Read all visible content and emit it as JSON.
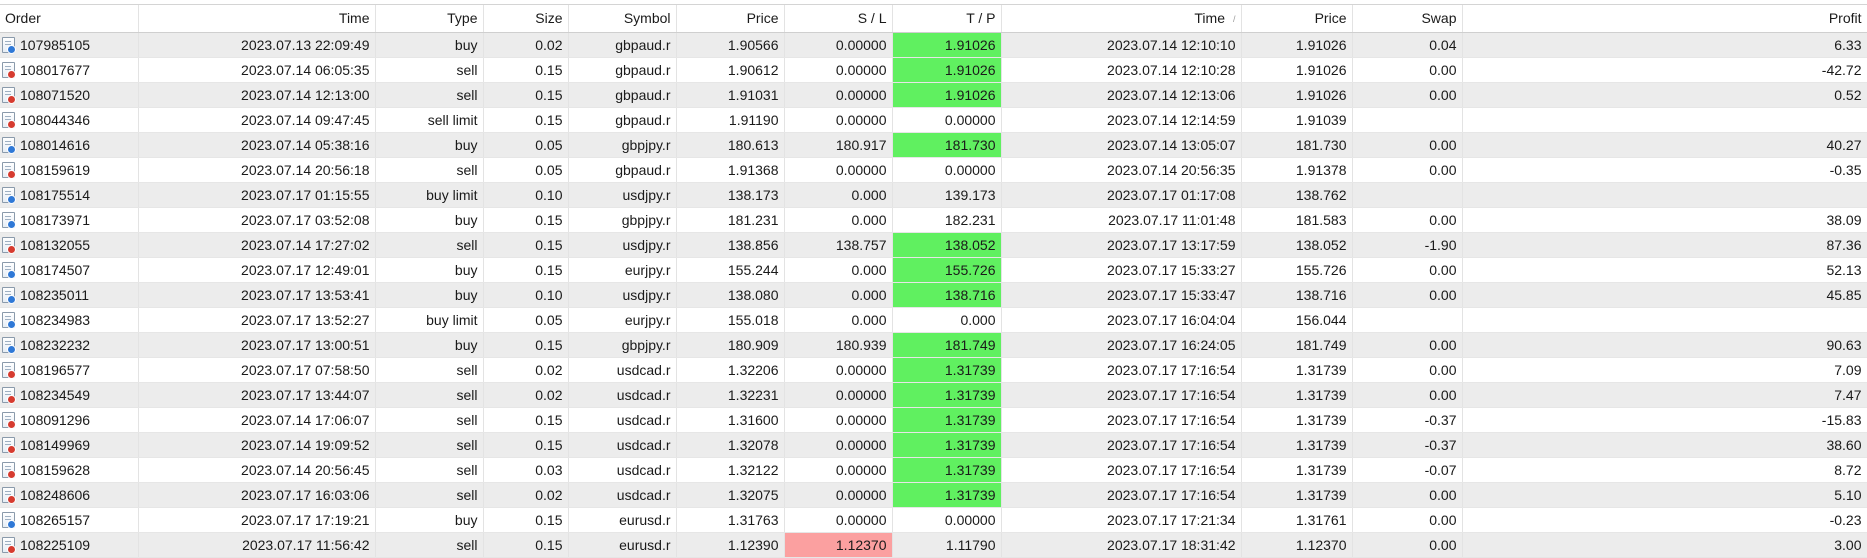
{
  "columns": [
    {
      "key": "order",
      "label": "Order"
    },
    {
      "key": "time",
      "label": "Time"
    },
    {
      "key": "type",
      "label": "Type"
    },
    {
      "key": "size",
      "label": "Size"
    },
    {
      "key": "symbol",
      "label": "Symbol"
    },
    {
      "key": "price",
      "label": "Price"
    },
    {
      "key": "sl",
      "label": "S / L"
    },
    {
      "key": "tp",
      "label": "T / P"
    },
    {
      "key": "close_time",
      "label": "Time",
      "sort_indicator": "/"
    },
    {
      "key": "close_price",
      "label": "Price"
    },
    {
      "key": "swap",
      "label": "Swap"
    },
    {
      "key": "profit",
      "label": "Profit"
    }
  ],
  "colors": {
    "hit_tp": "#60f060",
    "hit_sl": "#fba0a0",
    "buy_icon": "#2f78d6",
    "sell_icon": "#d63b2f"
  },
  "rows": [
    {
      "order": "107985105",
      "time": "2023.07.13 22:09:49",
      "type": "buy",
      "size": "0.02",
      "symbol": "gbpaud.r",
      "price": "1.90566",
      "sl": "0.00000",
      "tp": "1.91026",
      "close_time": "2023.07.14 12:10:10",
      "close_price": "1.91026",
      "swap": "0.04",
      "profit": "6.33",
      "highlight": "tp"
    },
    {
      "order": "108017677",
      "time": "2023.07.14 06:05:35",
      "type": "sell",
      "size": "0.15",
      "symbol": "gbpaud.r",
      "price": "1.90612",
      "sl": "0.00000",
      "tp": "1.91026",
      "close_time": "2023.07.14 12:10:28",
      "close_price": "1.91026",
      "swap": "0.00",
      "profit": "-42.72",
      "highlight": "tp"
    },
    {
      "order": "108071520",
      "time": "2023.07.14 12:13:00",
      "type": "sell",
      "size": "0.15",
      "symbol": "gbpaud.r",
      "price": "1.91031",
      "sl": "0.00000",
      "tp": "1.91026",
      "close_time": "2023.07.14 12:13:06",
      "close_price": "1.91026",
      "swap": "0.00",
      "profit": "0.52",
      "highlight": "tp"
    },
    {
      "order": "108044346",
      "time": "2023.07.14 09:47:45",
      "type": "sell limit",
      "size": "0.15",
      "symbol": "gbpaud.r",
      "price": "1.91190",
      "sl": "0.00000",
      "tp": "0.00000",
      "close_time": "2023.07.14 12:14:59",
      "close_price": "1.91039",
      "swap": "",
      "profit": "",
      "highlight": ""
    },
    {
      "order": "108014616",
      "time": "2023.07.14 05:38:16",
      "type": "buy",
      "size": "0.05",
      "symbol": "gbpjpy.r",
      "price": "180.613",
      "sl": "180.917",
      "tp": "181.730",
      "close_time": "2023.07.14 13:05:07",
      "close_price": "181.730",
      "swap": "0.00",
      "profit": "40.27",
      "highlight": "tp"
    },
    {
      "order": "108159619",
      "time": "2023.07.14 20:56:18",
      "type": "sell",
      "size": "0.05",
      "symbol": "gbpaud.r",
      "price": "1.91368",
      "sl": "0.00000",
      "tp": "0.00000",
      "close_time": "2023.07.14 20:56:35",
      "close_price": "1.91378",
      "swap": "0.00",
      "profit": "-0.35",
      "highlight": ""
    },
    {
      "order": "108175514",
      "time": "2023.07.17 01:15:55",
      "type": "buy limit",
      "size": "0.10",
      "symbol": "usdjpy.r",
      "price": "138.173",
      "sl": "0.000",
      "tp": "139.173",
      "close_time": "2023.07.17 01:17:08",
      "close_price": "138.762",
      "swap": "",
      "profit": "",
      "highlight": ""
    },
    {
      "order": "108173971",
      "time": "2023.07.17 03:52:08",
      "type": "buy",
      "size": "0.15",
      "symbol": "gbpjpy.r",
      "price": "181.231",
      "sl": "0.000",
      "tp": "182.231",
      "close_time": "2023.07.17 11:01:48",
      "close_price": "181.583",
      "swap": "0.00",
      "profit": "38.09",
      "highlight": ""
    },
    {
      "order": "108132055",
      "time": "2023.07.14 17:27:02",
      "type": "sell",
      "size": "0.15",
      "symbol": "usdjpy.r",
      "price": "138.856",
      "sl": "138.757",
      "tp": "138.052",
      "close_time": "2023.07.17 13:17:59",
      "close_price": "138.052",
      "swap": "-1.90",
      "profit": "87.36",
      "highlight": "tp"
    },
    {
      "order": "108174507",
      "time": "2023.07.17 12:49:01",
      "type": "buy",
      "size": "0.15",
      "symbol": "eurjpy.r",
      "price": "155.244",
      "sl": "0.000",
      "tp": "155.726",
      "close_time": "2023.07.17 15:33:27",
      "close_price": "155.726",
      "swap": "0.00",
      "profit": "52.13",
      "highlight": "tp"
    },
    {
      "order": "108235011",
      "time": "2023.07.17 13:53:41",
      "type": "buy",
      "size": "0.10",
      "symbol": "usdjpy.r",
      "price": "138.080",
      "sl": "0.000",
      "tp": "138.716",
      "close_time": "2023.07.17 15:33:47",
      "close_price": "138.716",
      "swap": "0.00",
      "profit": "45.85",
      "highlight": "tp"
    },
    {
      "order": "108234983",
      "time": "2023.07.17 13:52:27",
      "type": "buy limit",
      "size": "0.05",
      "symbol": "eurjpy.r",
      "price": "155.018",
      "sl": "0.000",
      "tp": "0.000",
      "close_time": "2023.07.17 16:04:04",
      "close_price": "156.044",
      "swap": "",
      "profit": "",
      "highlight": ""
    },
    {
      "order": "108232232",
      "time": "2023.07.17 13:00:51",
      "type": "buy",
      "size": "0.15",
      "symbol": "gbpjpy.r",
      "price": "180.909",
      "sl": "180.939",
      "tp": "181.749",
      "close_time": "2023.07.17 16:24:05",
      "close_price": "181.749",
      "swap": "0.00",
      "profit": "90.63",
      "highlight": "tp"
    },
    {
      "order": "108196577",
      "time": "2023.07.17 07:58:50",
      "type": "sell",
      "size": "0.02",
      "symbol": "usdcad.r",
      "price": "1.32206",
      "sl": "0.00000",
      "tp": "1.31739",
      "close_time": "2023.07.17 17:16:54",
      "close_price": "1.31739",
      "swap": "0.00",
      "profit": "7.09",
      "highlight": "tp"
    },
    {
      "order": "108234549",
      "time": "2023.07.17 13:44:07",
      "type": "sell",
      "size": "0.02",
      "symbol": "usdcad.r",
      "price": "1.32231",
      "sl": "0.00000",
      "tp": "1.31739",
      "close_time": "2023.07.17 17:16:54",
      "close_price": "1.31739",
      "swap": "0.00",
      "profit": "7.47",
      "highlight": "tp"
    },
    {
      "order": "108091296",
      "time": "2023.07.14 17:06:07",
      "type": "sell",
      "size": "0.15",
      "symbol": "usdcad.r",
      "price": "1.31600",
      "sl": "0.00000",
      "tp": "1.31739",
      "close_time": "2023.07.17 17:16:54",
      "close_price": "1.31739",
      "swap": "-0.37",
      "profit": "-15.83",
      "highlight": "tp"
    },
    {
      "order": "108149969",
      "time": "2023.07.14 19:09:52",
      "type": "sell",
      "size": "0.15",
      "symbol": "usdcad.r",
      "price": "1.32078",
      "sl": "0.00000",
      "tp": "1.31739",
      "close_time": "2023.07.17 17:16:54",
      "close_price": "1.31739",
      "swap": "-0.37",
      "profit": "38.60",
      "highlight": "tp"
    },
    {
      "order": "108159628",
      "time": "2023.07.14 20:56:45",
      "type": "sell",
      "size": "0.03",
      "symbol": "usdcad.r",
      "price": "1.32122",
      "sl": "0.00000",
      "tp": "1.31739",
      "close_time": "2023.07.17 17:16:54",
      "close_price": "1.31739",
      "swap": "-0.07",
      "profit": "8.72",
      "highlight": "tp"
    },
    {
      "order": "108248606",
      "time": "2023.07.17 16:03:06",
      "type": "sell",
      "size": "0.02",
      "symbol": "usdcad.r",
      "price": "1.32075",
      "sl": "0.00000",
      "tp": "1.31739",
      "close_time": "2023.07.17 17:16:54",
      "close_price": "1.31739",
      "swap": "0.00",
      "profit": "5.10",
      "highlight": "tp"
    },
    {
      "order": "108265157",
      "time": "2023.07.17 17:19:21",
      "type": "buy",
      "size": "0.15",
      "symbol": "eurusd.r",
      "price": "1.31763",
      "sl": "0.00000",
      "tp": "0.00000",
      "close_time": "2023.07.17 17:21:34",
      "close_price": "1.31761",
      "swap": "0.00",
      "profit": "-0.23",
      "highlight": ""
    },
    {
      "order": "108225109",
      "time": "2023.07.17 11:56:42",
      "type": "sell",
      "size": "0.15",
      "symbol": "eurusd.r",
      "price": "1.12390",
      "sl": "1.12370",
      "tp": "1.11790",
      "close_time": "2023.07.17 18:31:42",
      "close_price": "1.12370",
      "swap": "0.00",
      "profit": "3.00",
      "highlight": "sl"
    }
  ]
}
